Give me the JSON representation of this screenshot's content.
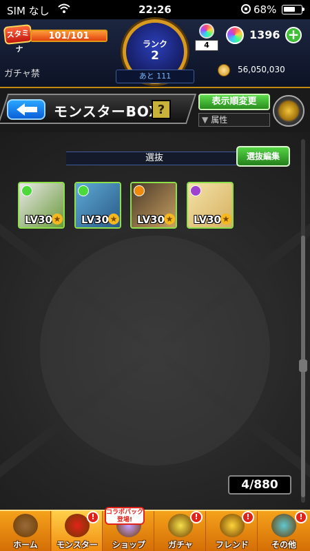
{
  "status_bar": {
    "carrier": "SIM なし",
    "time": "22:26",
    "battery": "68%",
    "battery_level": 0.68,
    "icons": [
      "wifi-icon",
      "rotation-lock-icon",
      "battery-icon"
    ]
  },
  "header": {
    "stamina_label": "スタミナ",
    "stamina_text": "101/101",
    "stamina_fraction": 1.0,
    "rank_label": "ランク",
    "rank_value": "2",
    "next_rank_text": "あと 111",
    "stock_count": "4",
    "orb_count": "1396",
    "gacha_ban_text": "ガチャ禁",
    "gold_count": "56,050,030"
  },
  "title_row": {
    "page_title": "モンスターBOX",
    "help_label": "?",
    "sort_label": "表示順変更",
    "filter_label": "属性"
  },
  "box": {
    "section_label": "選抜",
    "edit_label": "選抜編集",
    "count_text": "4/880",
    "monsters": [
      {
        "level": "LV30",
        "attribute_color": "#4cd93c",
        "art_colors": [
          "#e8e8e8",
          "#6a9a3a"
        ]
      },
      {
        "level": "LV30",
        "attribute_color": "#4cd93c",
        "art_colors": [
          "#5ea9d6",
          "#2a5a86"
        ]
      },
      {
        "level": "LV30",
        "attribute_color": "#f08a0e",
        "art_colors": [
          "#4a3a2a",
          "#c9a060"
        ]
      },
      {
        "level": "LV30",
        "attribute_color": "#a040d0",
        "art_colors": [
          "#f3e2a8",
          "#d6b060"
        ]
      }
    ]
  },
  "bottom_nav": {
    "collab_tag": "コラボパック登場!",
    "items": [
      {
        "label": "ホーム",
        "icon": "home-icon",
        "color": "#9a6b3a",
        "alert": ""
      },
      {
        "label": "モンスター",
        "icon": "monster-icon",
        "color": "#e0231a",
        "alert": "!"
      },
      {
        "label": "ショップ",
        "icon": "shop-orb-icon",
        "color": "#c6a0ff",
        "alert": ""
      },
      {
        "label": "ガチャ",
        "icon": "gacha-icon",
        "color": "#f5e04a",
        "alert": "!"
      },
      {
        "label": "フレンド",
        "icon": "friend-icon",
        "color": "#ffd43a",
        "alert": "!"
      },
      {
        "label": "その他",
        "icon": "other-icon",
        "color": "#5fc8d0",
        "alert": "!"
      }
    ]
  }
}
